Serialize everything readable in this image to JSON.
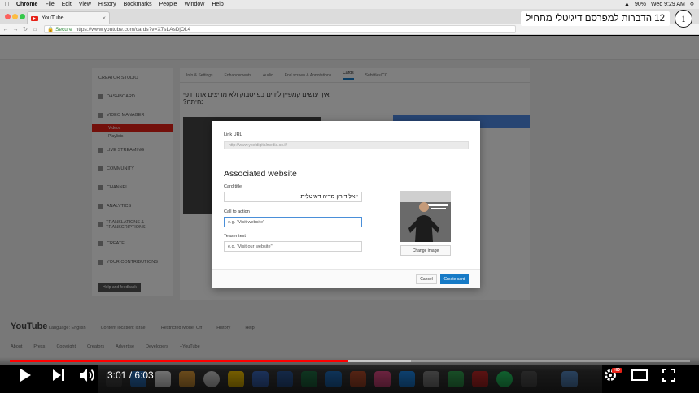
{
  "menubar": {
    "app": "Chrome",
    "items": [
      "File",
      "Edit",
      "View",
      "History",
      "Bookmarks",
      "People",
      "Window",
      "Help"
    ],
    "battery": "90%",
    "clock": "Wed 9:29 AM"
  },
  "browser": {
    "tab_title": "YouTube",
    "secure_label": "Secure",
    "url": "https://www.youtube.com/cards?v=X7sLAsDjOL4"
  },
  "studio": {
    "sidebar_heading": "CREATOR STUDIO",
    "sidebar_items": [
      "DASHBOARD",
      "VIDEO MANAGER",
      "LIVE STREAMING",
      "COMMUNITY",
      "CHANNEL",
      "ANALYTICS",
      "TRANSLATIONS & TRANSCRIPTIONS",
      "CREATE",
      "YOUR CONTRIBUTIONS"
    ],
    "sidebar_sub_active": "Videos",
    "sidebar_sub": "Playlists",
    "help_button": "Help and feedback",
    "editor_tabs": [
      "Info & Settings",
      "Enhancements",
      "Audio",
      "End screen & Annotations",
      "Cards",
      "Subtitles/CC"
    ],
    "video_title": "איך עושים קמפיין לידים בפייסבוק ולא מריצים אתר דפי נחיתה?",
    "footer_links": [
      "Language: English",
      "Content location: Israel",
      "Restricted Mode: Off",
      "History",
      "Help"
    ],
    "footer_links2": [
      "About",
      "Press",
      "Copyright",
      "Creators",
      "Advertise",
      "Developers",
      "+YouTube"
    ],
    "footer_logo": "YouTube"
  },
  "modal": {
    "link_url_label": "Link URL",
    "link_url_value": "http://www.yoeldigitalmedia.co.il/",
    "section_title": "Associated website",
    "card_title_label": "Card title",
    "card_title_value": "יואל דורון מדיה דיגיטלית",
    "cta_label": "Call to action",
    "cta_placeholder": "e.g. \"Visit website\"",
    "teaser_label": "Teaser text",
    "teaser_placeholder": "e.g. \"Visit our website\"",
    "change_image": "Change image",
    "cancel": "Cancel",
    "create": "Create card"
  },
  "overlay": {
    "title": "12 הדברות למפרסם דיגיטלי מתחיל"
  },
  "player": {
    "current_time": "3:01",
    "separator": " / ",
    "duration": "6:03",
    "played_fraction": 0.498,
    "buffered_fraction": 0.59,
    "hd": "HD"
  },
  "colors": {
    "accent": "#e62117",
    "studio_blue": "#167ac6",
    "progress_red": "#ff0000"
  }
}
